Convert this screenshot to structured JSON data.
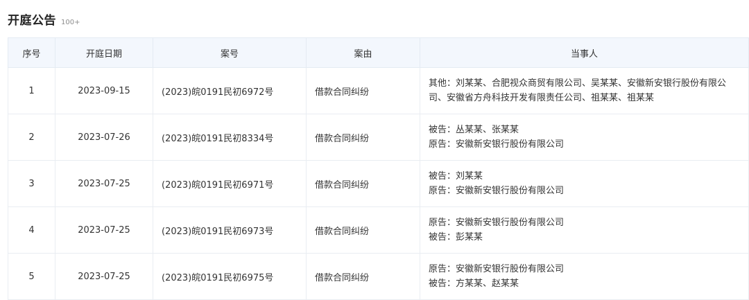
{
  "section": {
    "title": "开庭公告",
    "count": "100+"
  },
  "table": {
    "headers": [
      "序号",
      "开庭日期",
      "案号",
      "案由",
      "当事人"
    ],
    "rows": [
      {
        "index": "1",
        "date": "2023-09-15",
        "case_no": "(2023)皖0191民初6972号",
        "cause": "借款合同纠纷",
        "parties": [
          "其他：刘某某、合肥视众商贸有限公司、吴某某、安徽新安银行股份有限公司、安徽省方舟科技开发有限责任公司、祖某某、祖某某"
        ]
      },
      {
        "index": "2",
        "date": "2023-07-26",
        "case_no": "(2023)皖0191民初8334号",
        "cause": "借款合同纠纷",
        "parties": [
          "被告：丛某某、张某某",
          "原告：安徽新安银行股份有限公司"
        ]
      },
      {
        "index": "3",
        "date": "2023-07-25",
        "case_no": "(2023)皖0191民初6971号",
        "cause": "借款合同纠纷",
        "parties": [
          "被告：刘某某",
          "原告：安徽新安银行股份有限公司"
        ]
      },
      {
        "index": "4",
        "date": "2023-07-25",
        "case_no": "(2023)皖0191民初6973号",
        "cause": "借款合同纠纷",
        "parties": [
          "原告：安徽新安银行股份有限公司",
          "被告：彭某某"
        ]
      },
      {
        "index": "5",
        "date": "2023-07-25",
        "case_no": "(2023)皖0191民初6975号",
        "cause": "借款合同纠纷",
        "parties": [
          "原告：安徽新安银行股份有限公司",
          "被告：方某某、赵某某"
        ]
      }
    ]
  }
}
